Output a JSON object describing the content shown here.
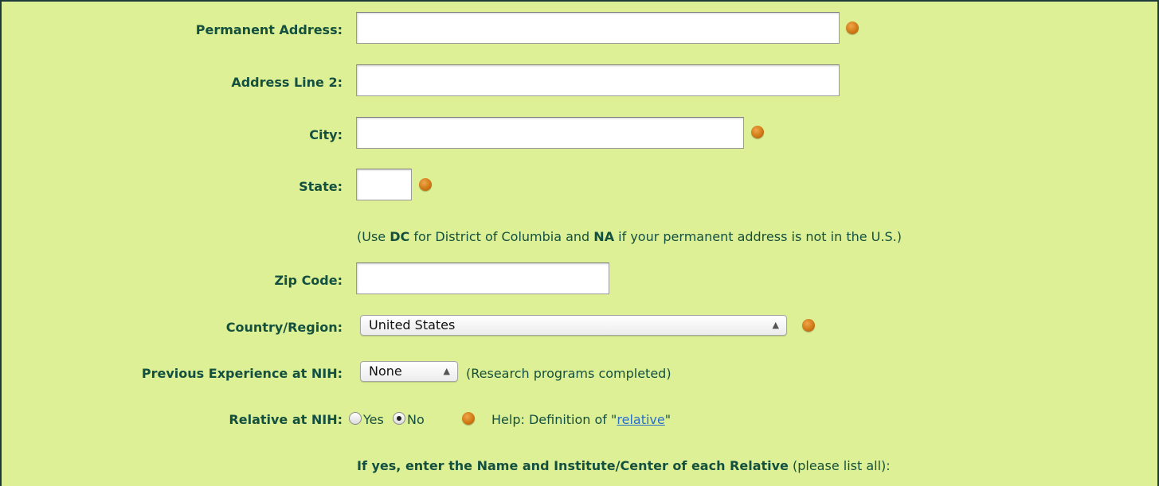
{
  "form": {
    "permanent_address": {
      "label": "Permanent Address:",
      "value": ""
    },
    "address_line_2": {
      "label": "Address Line 2:",
      "value": ""
    },
    "city": {
      "label": "City:",
      "value": ""
    },
    "state": {
      "label": "State:",
      "value": ""
    },
    "state_note": {
      "prefix": "(Use ",
      "dc": "DC",
      "mid": " for District of Columbia and ",
      "na": "NA",
      "suffix": " if your permanent address is not in the U.S.)"
    },
    "zip": {
      "label": "Zip Code:",
      "value": ""
    },
    "country": {
      "label": "Country/Region:",
      "selected": "United States"
    },
    "previous_experience": {
      "label": "Previous Experience at NIH:",
      "selected": "None",
      "note": "(Research programs completed)"
    },
    "relative": {
      "label": "Relative at NIH:",
      "yes": "Yes",
      "no": "No",
      "selected": "No",
      "help_prefix": "Help: Definition of \"",
      "help_link": "relative",
      "help_suffix": "\""
    },
    "relative_instructions": {
      "bold": "If yes, enter the Name and Institute/Center of each Relative",
      "rest": " (please list all):"
    }
  },
  "colors": {
    "background": "#ddf095",
    "label": "#14503f",
    "required_dot": "#d07a16",
    "link": "#2a6fc9"
  }
}
